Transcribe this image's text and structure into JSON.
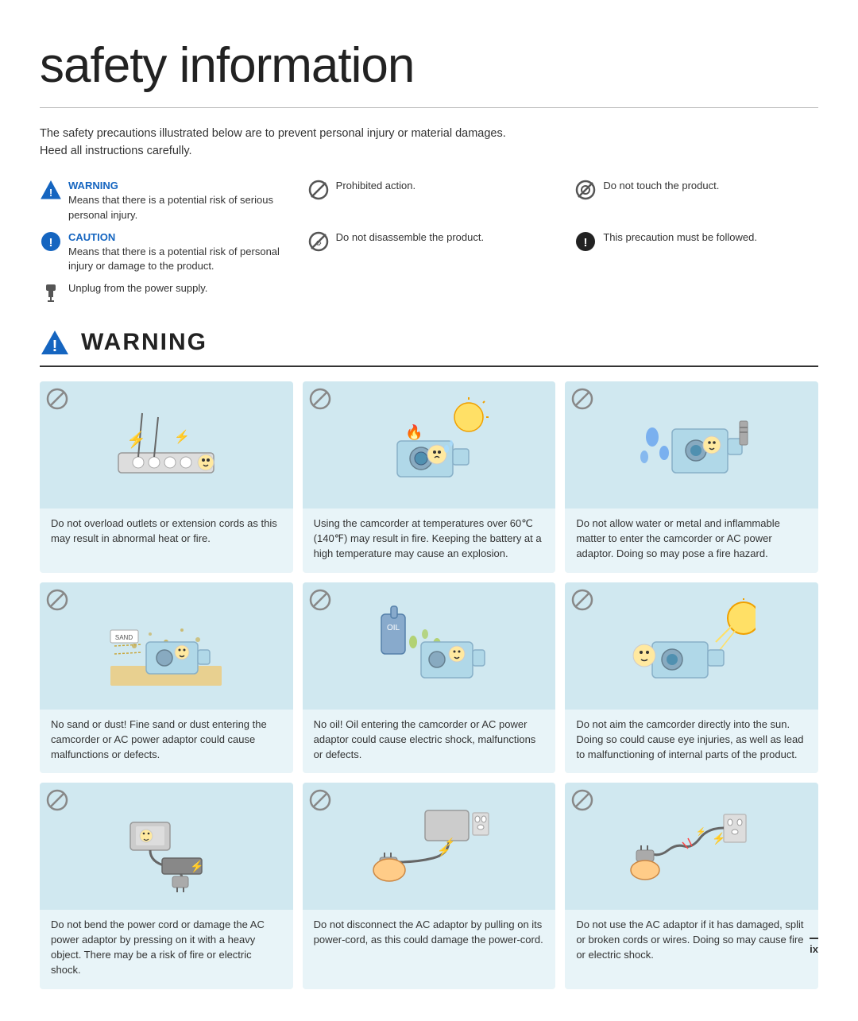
{
  "page": {
    "title": "safety information",
    "intro": "The safety precautions illustrated below are to prevent personal injury or material damages.\nHeed all instructions carefully.",
    "page_number": "ix"
  },
  "legend": {
    "items": [
      {
        "id": "warning-def",
        "icon_type": "warning-triangle",
        "label": "WARNING",
        "label_class": "label-warning",
        "text": "Means that there is a potential risk of serious personal injury."
      },
      {
        "id": "prohibited-def",
        "icon_type": "prohibited",
        "label": "",
        "text": "Prohibited action."
      },
      {
        "id": "no-touch-def",
        "icon_type": "no-touch",
        "label": "",
        "text": "Do not touch the product."
      },
      {
        "id": "caution-def",
        "icon_type": "caution-circle",
        "label": "CAUTION",
        "label_class": "label-caution",
        "text": "Means that there is a potential risk of personal injury or damage to the product."
      },
      {
        "id": "no-disassemble-def",
        "icon_type": "no-disassemble",
        "label": "",
        "text": "Do not disassemble the product."
      },
      {
        "id": "must-follow-def",
        "icon_type": "must-follow",
        "label": "",
        "text": "This precaution must be followed."
      },
      {
        "id": "unplug-def",
        "icon_type": "unplug",
        "label": "",
        "text": "Unplug from the power supply."
      }
    ]
  },
  "warning_section": {
    "header": "WARNING",
    "cards": [
      {
        "id": "overload",
        "text": "Do not overload outlets or extension cords as this may result in abnormal heat or fire.",
        "icon_type": "prohibited-card"
      },
      {
        "id": "temperature",
        "text": "Using the camcorder at temperatures over 60℃ (140℉) may result in fire. Keeping the battery at a high temperature may cause an explosion.",
        "icon_type": "prohibited-card"
      },
      {
        "id": "water-metal",
        "text": "Do not allow water or metal and inflammable matter to enter the camcorder or AC power adaptor. Doing so may pose a fire hazard.",
        "icon_type": "prohibited-card"
      },
      {
        "id": "sand-dust",
        "text": "No sand or dust! Fine sand or dust entering the camcorder or AC power adaptor could cause malfunctions or defects.",
        "icon_type": "prohibited-card"
      },
      {
        "id": "oil",
        "text": "No oil! Oil entering the camcorder or AC power adaptor could cause electric shock, malfunctions or defects.",
        "icon_type": "prohibited-card"
      },
      {
        "id": "sun",
        "text": "Do not aim the camcorder directly into the sun. Doing so could cause eye injuries, as well as lead to malfunctioning of internal parts of the product.",
        "icon_type": "prohibited-card"
      },
      {
        "id": "power-cord",
        "text": "Do not bend the power cord or damage the AC power adaptor by pressing on it with a heavy object. There may be a risk of fire or electric shock.",
        "icon_type": "prohibited-card"
      },
      {
        "id": "disconnect",
        "text": "Do not disconnect the AC adaptor by pulling on its power-cord, as this could damage the power-cord.",
        "icon_type": "prohibited-card"
      },
      {
        "id": "damaged-adaptor",
        "text": "Do not use the AC adaptor if it has damaged, split or broken cords or wires. Doing so may cause fire or electric shock.",
        "icon_type": "prohibited-card"
      }
    ]
  }
}
